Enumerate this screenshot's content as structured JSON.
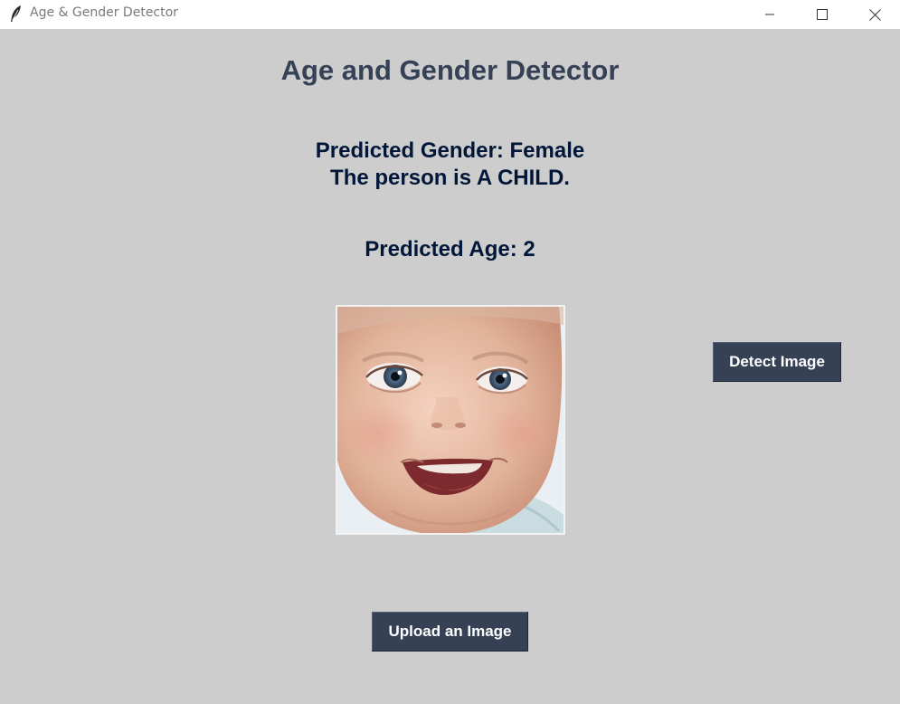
{
  "window": {
    "title": "Age & Gender Detector",
    "controls": {
      "minimize": "minimize-icon",
      "maximize": "maximize-icon",
      "close": "close-icon"
    }
  },
  "main": {
    "heading": "Age and Gender Detector",
    "gender_line": "Predicted Gender: Female",
    "category_line": "The person is A CHILD.",
    "age_line": "Predicted Age: 2",
    "photo": {
      "subject": "baby-face-photo"
    }
  },
  "buttons": {
    "detect": "Detect Image",
    "upload": "Upload an Image"
  },
  "colors": {
    "background": "#cdcdcd",
    "heading": "#364156",
    "label": "#011638",
    "button_bg": "#364156",
    "button_text": "#ffffff"
  }
}
